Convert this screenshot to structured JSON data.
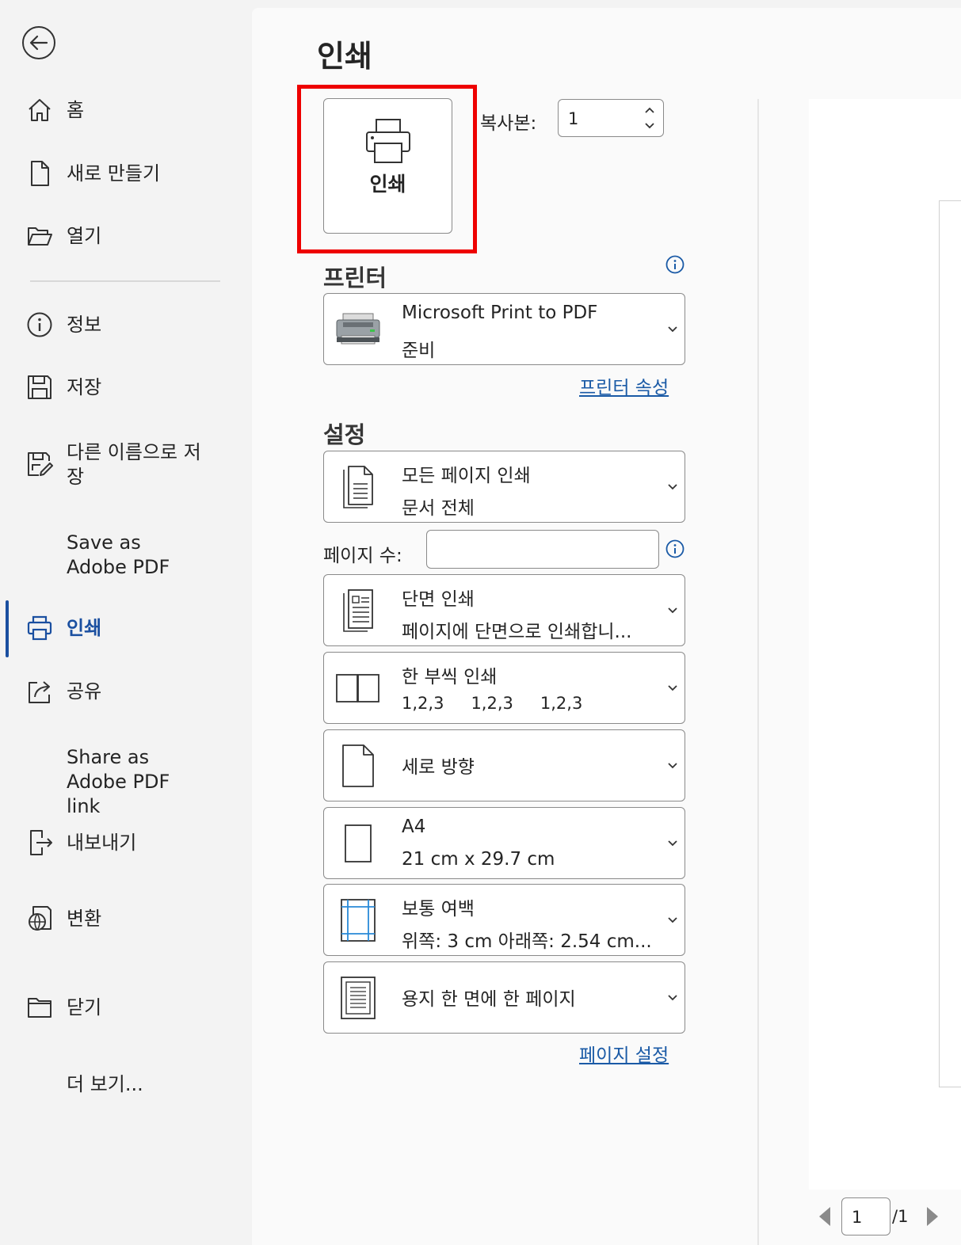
{
  "sidebar": {
    "items": [
      {
        "label": "홈",
        "icon": "home-icon"
      },
      {
        "label": "새로 만들기",
        "icon": "new-document-icon"
      },
      {
        "label": "열기",
        "icon": "folder-open-icon"
      },
      {
        "label": "정보",
        "icon": "info-icon"
      },
      {
        "label": "저장",
        "icon": "save-icon"
      },
      {
        "label": "다른 이름으로 저장",
        "icon": "save-as-icon"
      },
      {
        "label": "Save as Adobe PDF",
        "icon": ""
      },
      {
        "label": "인쇄",
        "icon": "printer-icon",
        "active": true
      },
      {
        "label": "공유",
        "icon": "share-icon"
      },
      {
        "label": "Share as Adobe PDF link",
        "icon": ""
      },
      {
        "label": "내보내기",
        "icon": "export-icon"
      },
      {
        "label": "변환",
        "icon": "transform-icon"
      },
      {
        "label": "닫기",
        "icon": "close-folder-icon"
      },
      {
        "label": "더 보기...",
        "icon": ""
      }
    ]
  },
  "main": {
    "title": "인쇄",
    "print_button_label": "인쇄",
    "copies": {
      "label": "복사본:",
      "value": "1"
    },
    "printer": {
      "section_title": "프린터",
      "name": "Microsoft Print to PDF",
      "status": "준비",
      "properties_link": "프린터 속성"
    },
    "settings": {
      "section_title": "설정",
      "range": {
        "line1": "모든 페이지 인쇄",
        "line2": "문서 전체"
      },
      "pages_label": "페이지 수:",
      "pages_value": "",
      "sides": {
        "line1": "단면 인쇄",
        "line2": "페이지에 단면으로 인쇄합니..."
      },
      "collation": {
        "line1": "한 부씩 인쇄",
        "sets": [
          "1,2,3",
          "1,2,3",
          "1,2,3"
        ]
      },
      "orientation": {
        "line1": "세로 방향"
      },
      "paper": {
        "line1": "A4",
        "line2": "21 cm x 29.7 cm"
      },
      "margins": {
        "line1": "보통 여백",
        "line2": "위쪽: 3 cm 아래쪽: 2.54 cm..."
      },
      "pages_per_sheet": {
        "line1": "용지 한 면에 한 페이지"
      },
      "page_setup_link": "페이지 설정"
    }
  },
  "preview": {
    "current_page": "1",
    "total": "/1"
  },
  "colors": {
    "accent": "#1a4fa0",
    "link": "#1a5aa6",
    "highlight": "#ee0000"
  }
}
